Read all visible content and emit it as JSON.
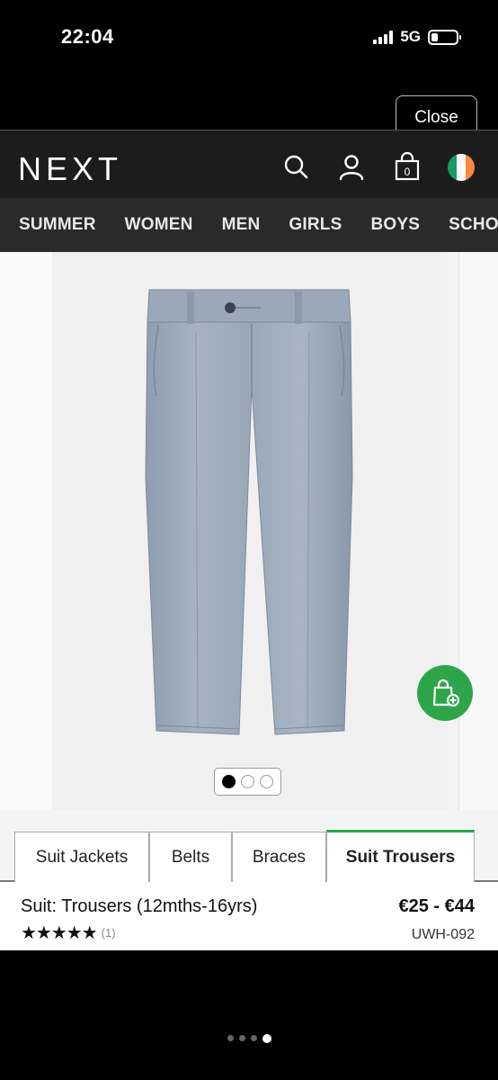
{
  "status_bar": {
    "time": "22:04",
    "network": "5G",
    "battery_level": 0.25
  },
  "overlay": {
    "close_label": "Close"
  },
  "header": {
    "logo": "NEXT",
    "icons": [
      "search-icon",
      "account-icon",
      "bag-icon",
      "ireland-flag-icon"
    ],
    "bag_count": "0"
  },
  "nav": {
    "items": [
      "SUMMER",
      "WOMEN",
      "MEN",
      "GIRLS",
      "BOYS",
      "SCHO"
    ]
  },
  "gallery": {
    "image_count": 3,
    "active_index": 0,
    "add_to_bag_icon": "shopping-bag-plus-icon",
    "accent_color": "#2da64a"
  },
  "tabs": {
    "items": [
      "Suit Jackets",
      "Belts",
      "Braces",
      "Suit Trousers"
    ],
    "active": "Suit Trousers"
  },
  "product": {
    "title": "Suit: Trousers (12mths-16yrs)",
    "rating_stars": "★★★★★",
    "review_count": "(1)",
    "price": "€25 - €44",
    "sku": "UWH-092"
  },
  "pager": {
    "count": 4,
    "active_index": 3
  }
}
